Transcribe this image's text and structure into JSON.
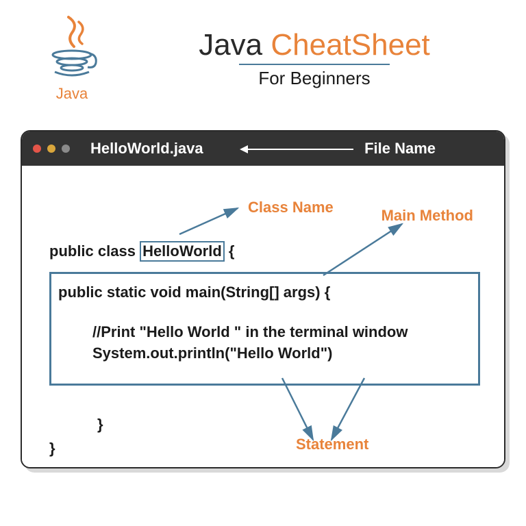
{
  "header": {
    "title_java": "Java ",
    "title_cheat": "CheatSheet",
    "subtitle": "For Beginners",
    "logo_text": "Java"
  },
  "window": {
    "filename": "HelloWorld.java",
    "filename_label": "File Name"
  },
  "labels": {
    "class_name": "Class Name",
    "main_method": "Main Method",
    "statement": "Statement"
  },
  "code": {
    "line1_pre": "public class ",
    "line1_class": "HelloWorld",
    "line1_post": " {",
    "main_sig": "public static void main(String[] args) {",
    "comment": "//Print \"Hello World \" in the terminal window",
    "println": "System.out.println(\"Hello World\")",
    "brace1": "}",
    "brace2": "}"
  }
}
